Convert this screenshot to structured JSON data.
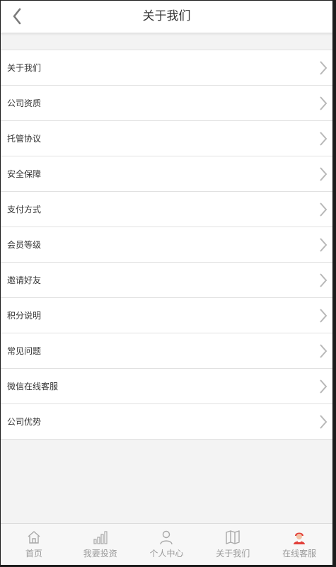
{
  "header": {
    "title": "关于我们",
    "back_icon": "chevron-left-icon"
  },
  "menu": {
    "items": [
      {
        "label": "关于我们",
        "icon": "chevron-right-icon"
      },
      {
        "label": "公司资质",
        "icon": "chevron-right-icon"
      },
      {
        "label": "托管协议",
        "icon": "chevron-right-icon"
      },
      {
        "label": "安全保障",
        "icon": "chevron-right-icon"
      },
      {
        "label": "支付方式",
        "icon": "chevron-right-icon"
      },
      {
        "label": "会员等级",
        "icon": "chevron-right-icon"
      },
      {
        "label": "邀请好友",
        "icon": "chevron-right-icon"
      },
      {
        "label": "积分说明",
        "icon": "chevron-right-icon"
      },
      {
        "label": "常见问题",
        "icon": "chevron-right-icon"
      },
      {
        "label": "微信在线客服",
        "icon": "chevron-right-icon"
      },
      {
        "label": "公司优势",
        "icon": "chevron-right-icon"
      }
    ]
  },
  "tabbar": {
    "tabs": [
      {
        "label": "首页",
        "icon": "home-icon"
      },
      {
        "label": "我要投资",
        "icon": "bar-chart-icon"
      },
      {
        "label": "个人中心",
        "icon": "user-icon"
      },
      {
        "label": "关于我们",
        "icon": "map-icon"
      },
      {
        "label": "在线客服",
        "icon": "customer-service-icon"
      }
    ]
  },
  "colors": {
    "text": "#333333",
    "muted": "#9a9a9a",
    "chevron": "#b8b8b8",
    "accent_red": "#e2403a"
  }
}
